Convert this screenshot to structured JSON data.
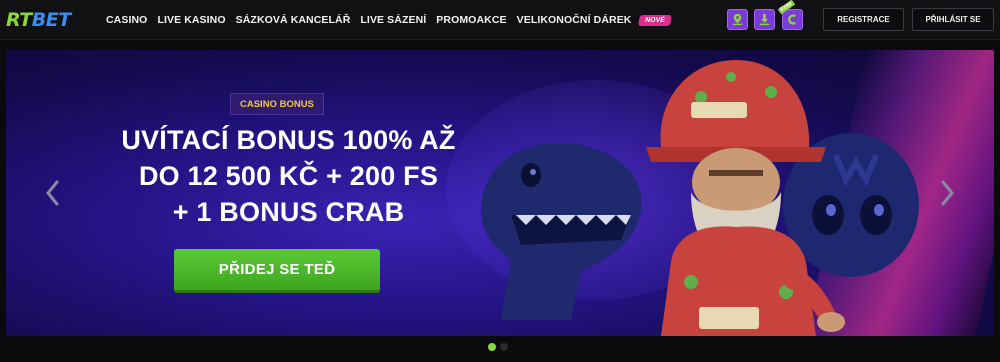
{
  "logo": {
    "part1": "RT",
    "part2": "BET"
  },
  "nav": {
    "items": [
      {
        "id": "casino",
        "label": "CASINO"
      },
      {
        "id": "live-kasino",
        "label": "LIVE KASINO"
      },
      {
        "id": "sazkova",
        "label": "SÁZKOVÁ KANCELÁŘ"
      },
      {
        "id": "live-sazeni",
        "label": "LIVE SÁZENÍ"
      },
      {
        "id": "promoakce",
        "label": "PROMOAKCE"
      },
      {
        "id": "velikonocni",
        "label": "VELIKONOČNÍ DÁREK"
      }
    ],
    "new_badge": "NOVÉ"
  },
  "header_icons": [
    {
      "name": "location-icon"
    },
    {
      "name": "download-icon"
    },
    {
      "name": "free-bonus-icon",
      "tag": "Free"
    }
  ],
  "buttons": {
    "register": "REGISTRACE",
    "login": "PŘIHLÁSIT SE"
  },
  "hero": {
    "tag": "CASINO BONUS",
    "headline": [
      "UVÍTACÍ BONUS 100% AŽ",
      "DO 12 500 KČ + 200 FS",
      "+ 1 BONUS CRAB"
    ],
    "cta": "PŘIDEJ SE TEĎ"
  },
  "carousel": {
    "slides": 2,
    "active": 1
  },
  "colors": {
    "accent_green": "#5bc935",
    "logo_green": "#8bd63a",
    "logo_blue": "#3b8df0",
    "badge_pink": "#d72f8a",
    "icon_purple": "#7a3bd6",
    "tag_gold": "#f5c838"
  }
}
